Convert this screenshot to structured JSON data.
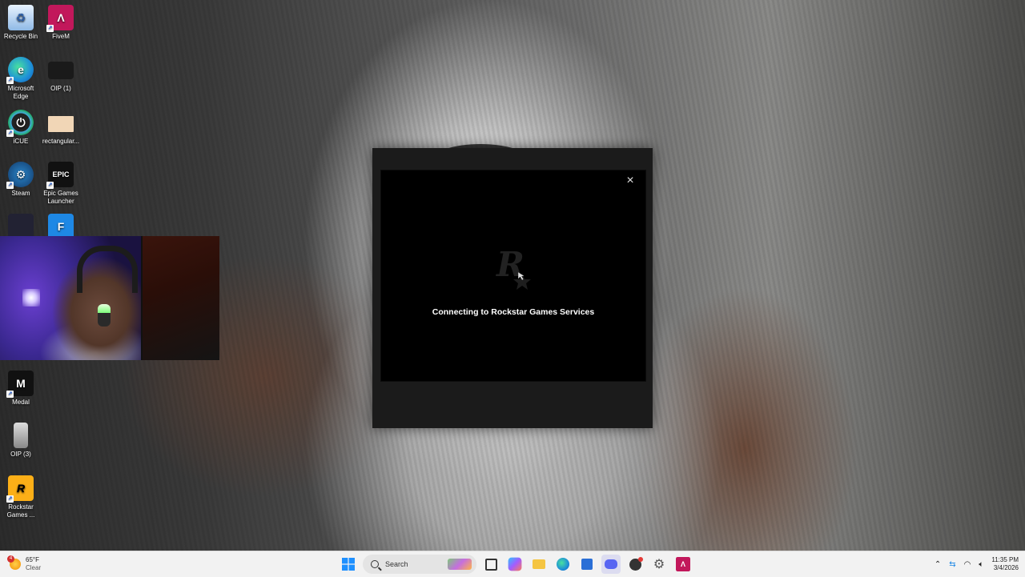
{
  "desktop": {
    "icons": [
      {
        "label": "Recycle Bin",
        "icon": "recycle-bin-icon"
      },
      {
        "label": "FiveM",
        "icon": "fivem-icon"
      },
      {
        "label": "Microsoft Edge",
        "icon": "edge-icon"
      },
      {
        "label": "OIP (1)",
        "icon": "image-file-icon"
      },
      {
        "label": "iCUE",
        "icon": "icue-icon"
      },
      {
        "label": "rectangular...",
        "icon": "image-file-icon"
      },
      {
        "label": "Steam",
        "icon": "steam-icon"
      },
      {
        "label": "Epic Games Launcher",
        "icon": "epic-games-icon"
      },
      {
        "label": "Medal",
        "icon": "medal-icon"
      },
      {
        "label": "OIP (3)",
        "icon": "image-file-icon"
      },
      {
        "label": "Rockstar Games ...",
        "icon": "rockstar-icon"
      }
    ]
  },
  "dialog": {
    "close_label": "×",
    "status_text": "Connecting to Rockstar Games Services",
    "logo": "rockstar-logo-icon"
  },
  "taskbar": {
    "weather_temp": "65°F",
    "weather_desc": "Clear",
    "weather_badge": "4",
    "search_placeholder": "Search",
    "time": "11:35 PM",
    "date": "3/4/2026",
    "pinned": [
      "start-icon",
      "search",
      "task-view-icon",
      "copilot-icon",
      "file-explorer-icon",
      "edge-icon",
      "store-icon",
      "discord-icon",
      "obs-icon",
      "settings-icon",
      "fivem-icon"
    ]
  },
  "colors": {
    "taskbar_bg": "#f2f2f2",
    "dialog_bg": "#1b1b1b",
    "dialog_inner": "#000000",
    "fivem_red": "#c2185b"
  }
}
